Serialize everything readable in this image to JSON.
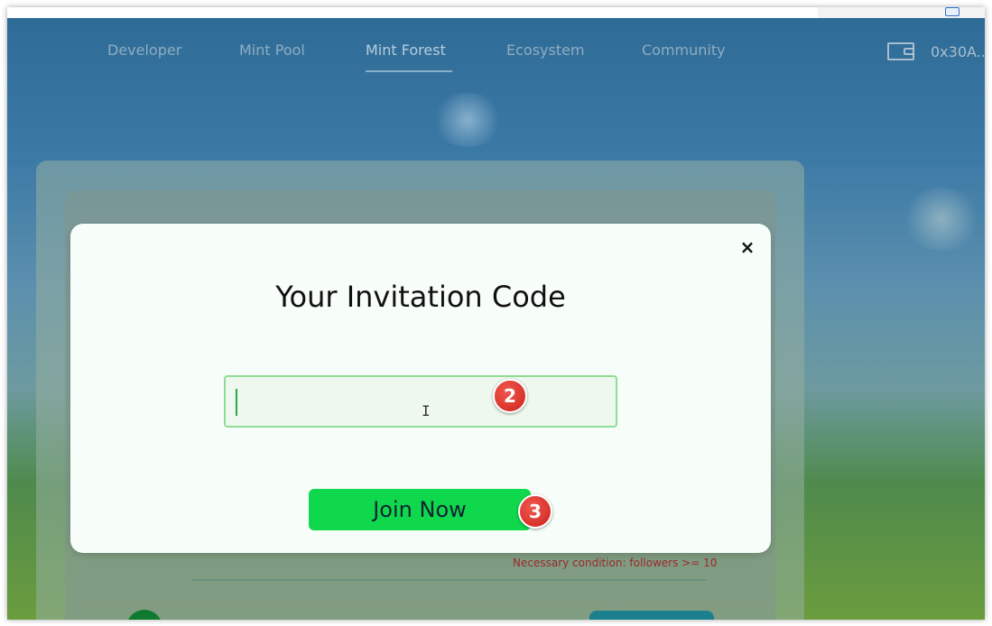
{
  "nav": {
    "items": [
      {
        "label": "Developer"
      },
      {
        "label": "Mint Pool"
      },
      {
        "label": "Mint Forest",
        "active": true
      },
      {
        "label": "Ecosystem"
      },
      {
        "label": "Community"
      }
    ],
    "wallet_address": "0x30A..."
  },
  "background": {
    "condition_text": "Necessary condition: followers >= 10"
  },
  "modal": {
    "title": "Your Invitation Code",
    "input_value": "",
    "input_placeholder": "",
    "join_label": "Join Now",
    "close_label": "×"
  },
  "annotations": {
    "step_2": "2",
    "step_3": "3"
  },
  "colors": {
    "accent_green": "#10d84c",
    "badge_red": "#d8322a",
    "condition_red": "#9b2a2a"
  }
}
